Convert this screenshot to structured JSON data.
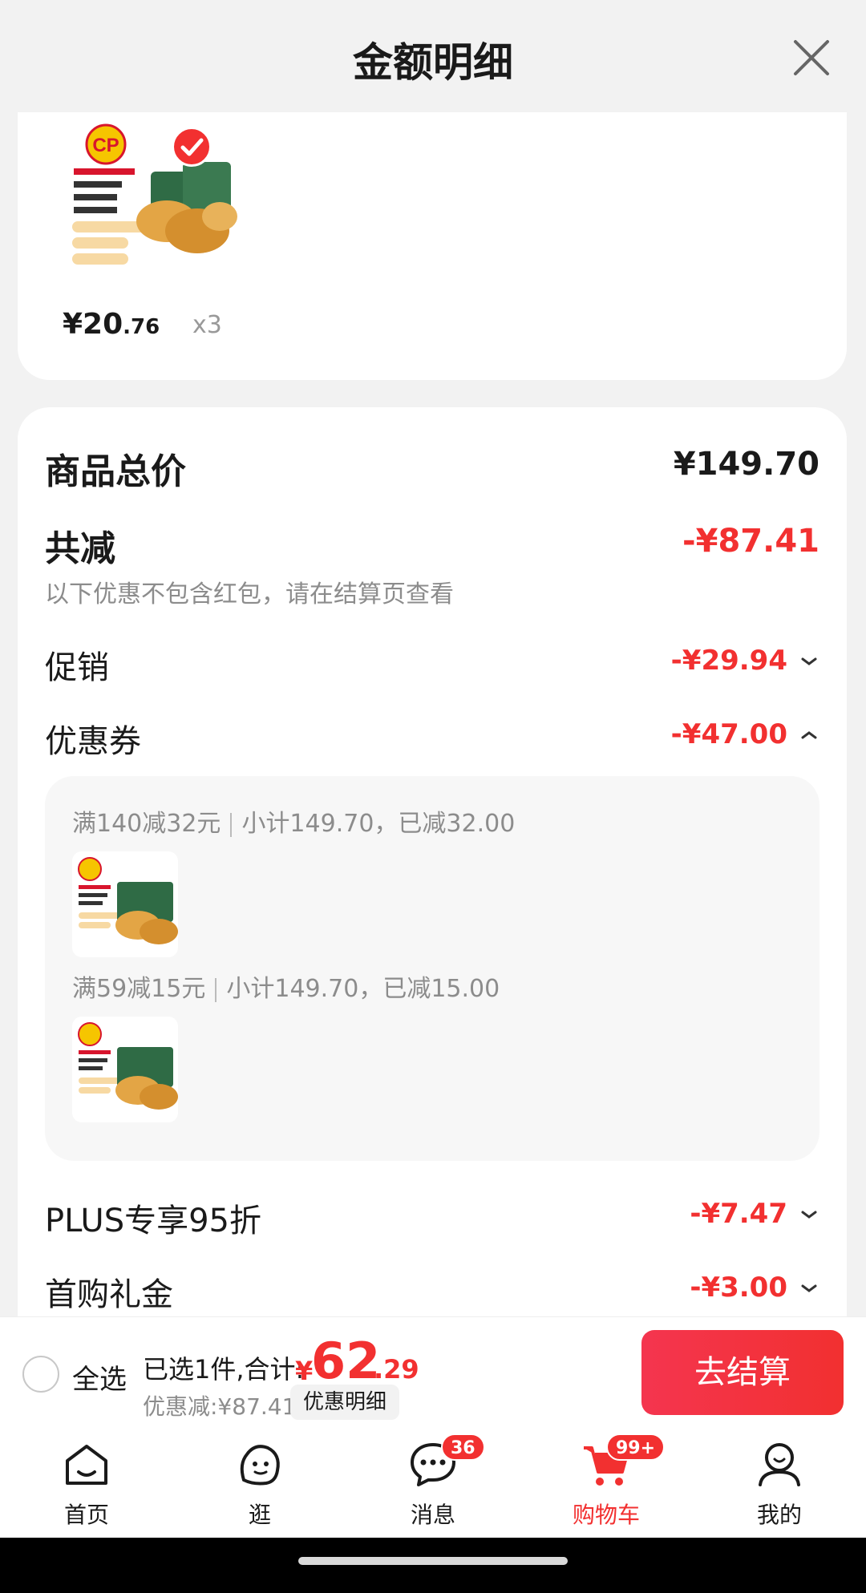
{
  "header": {
    "title": "金额明细"
  },
  "product": {
    "price_int": "¥20",
    "price_dec": ".76",
    "quantity": "x3",
    "brand_logo_text": "CP"
  },
  "summary": {
    "total_label": "商品总价",
    "total_value": "¥149.70",
    "reduce_label": "共减",
    "reduce_value": "-¥87.41",
    "note": "以下优惠不包含红包，请在结算页查看",
    "promo_label": "促销",
    "promo_value": "-¥29.94",
    "coupon_label": "优惠券",
    "coupon_value": "-¥47.00",
    "coupons": [
      {
        "rule": "满140减32元",
        "detail": "小计149.70，已减32.00"
      },
      {
        "rule": "满59减15元",
        "detail": "小计149.70，已减15.00"
      }
    ],
    "plus_label": "PLUS专享95折",
    "plus_value": "-¥7.47",
    "first_label": "首购礼金",
    "first_value": "-¥3.00"
  },
  "checkout": {
    "select_all": "全选",
    "selected_text": "已选1件,合计:",
    "yen": "¥",
    "total_int": "62",
    "total_dec": ".29",
    "discount_text": "优惠减:¥87.41",
    "detail_chip": "优惠明细",
    "checkout_button": "去结算"
  },
  "tabs": [
    {
      "label": "首页"
    },
    {
      "label": "逛"
    },
    {
      "label": "消息",
      "badge": "36"
    },
    {
      "label": "购物车",
      "badge": "99+"
    },
    {
      "label": "我的"
    }
  ],
  "colors": {
    "accent": "#f23030",
    "muted": "#8c8c8c"
  }
}
